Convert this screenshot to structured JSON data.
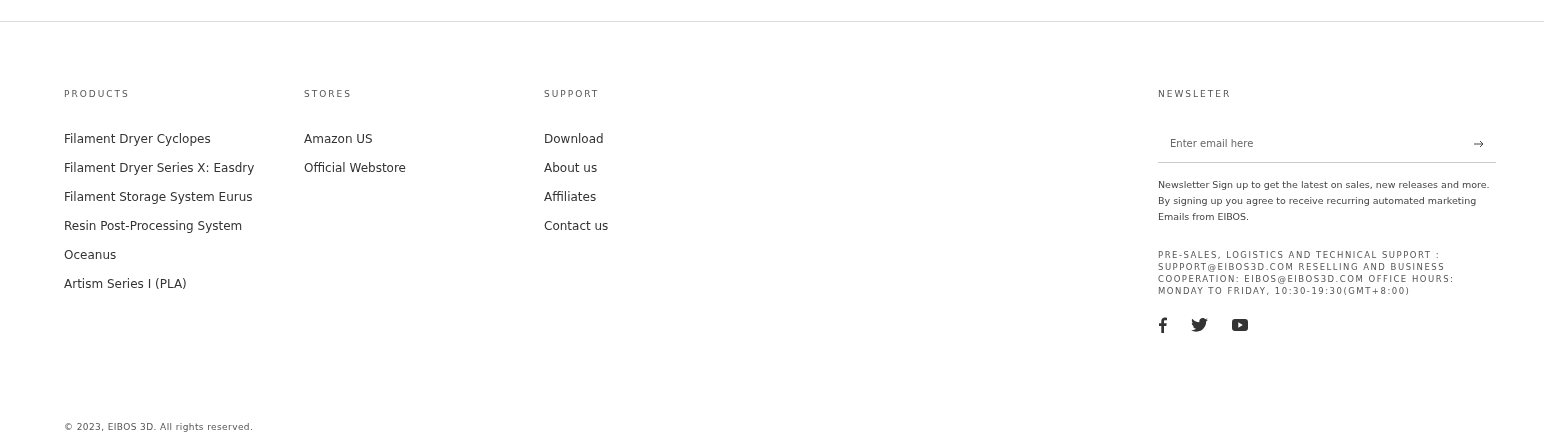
{
  "columns": [
    {
      "heading": "PRODUCTS",
      "links": [
        "Filament Dryer Cyclopes",
        "Filament Dryer Series X: Easdry",
        "Filament Storage System Eurus",
        "Resin Post-Processing System",
        "Oceanus",
        "Artism Series I (PLA)"
      ]
    },
    {
      "heading": "STORES",
      "links": [
        "Amazon US",
        "Official Webstore"
      ]
    },
    {
      "heading": "SUPPORT",
      "links": [
        "Download",
        "About us",
        "Affiliates",
        "Contact us"
      ]
    }
  ],
  "newsletter": {
    "heading": "NEWSLETER",
    "email": {
      "placeholder": "Enter email here"
    },
    "notice": "Newsletter Sign up to get the latest on sales, new releases and more. By signing up you agree to receive recurring automated marketing Emails from EIBOS.",
    "contact": "PRE-SALES, LOGISTICS AND TECHNICAL SUPPORT : SUPPORT@EIBOS3D.COM RESELLING AND BUSINESS COOPERATION: EIBOS@EIBOS3D.COM OFFICE HOURS: MONDAY TO FRIDAY, 10:30-19:30(GMT+8:00)",
    "social": [
      {
        "kind": "facebook"
      },
      {
        "kind": "twitter"
      },
      {
        "kind": "youtube"
      }
    ]
  },
  "copyright": "© 2023, EIBOS 3D. All rights reserved."
}
